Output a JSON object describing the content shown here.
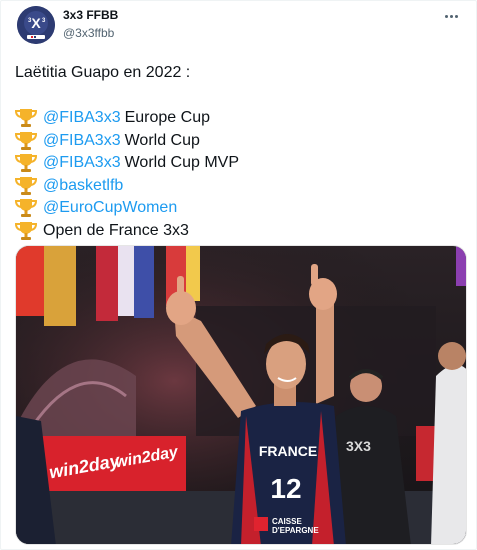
{
  "account": {
    "display_name": "3x3 FFBB",
    "handle": "@3x3ffbb",
    "avatar_icon": "3x3-ffbb-logo",
    "avatar_color": "#2c3a6e"
  },
  "more_icon": "more-options-icon",
  "tweet": {
    "intro": "Laëtitia Guapo en 2022 :",
    "items": [
      {
        "icon": "trophy-icon",
        "mention": "@FIBA3x3",
        "text": "Europe Cup"
      },
      {
        "icon": "trophy-icon",
        "mention": "@FIBA3x3",
        "text": "World Cup"
      },
      {
        "icon": "trophy-icon",
        "mention": "@FIBA3x3",
        "text": "World Cup MVP"
      },
      {
        "icon": "trophy-icon",
        "mention": "@basketlfb",
        "text": ""
      },
      {
        "icon": "trophy-icon",
        "mention": "@EuroCupWomen",
        "text": ""
      },
      {
        "icon": "trophy-icon",
        "mention": "",
        "text": "Open de France 3x3"
      }
    ],
    "link_color": "#1d9bf0"
  },
  "media": {
    "jersey_country": "FRANCE",
    "jersey_number": "12",
    "sponsor_line1": "CAISSE",
    "sponsor_line2": "D'EPARGNE",
    "board_text_1": "win2day",
    "board_text_2": "win2day",
    "ref_shirt_text": "3X3"
  }
}
